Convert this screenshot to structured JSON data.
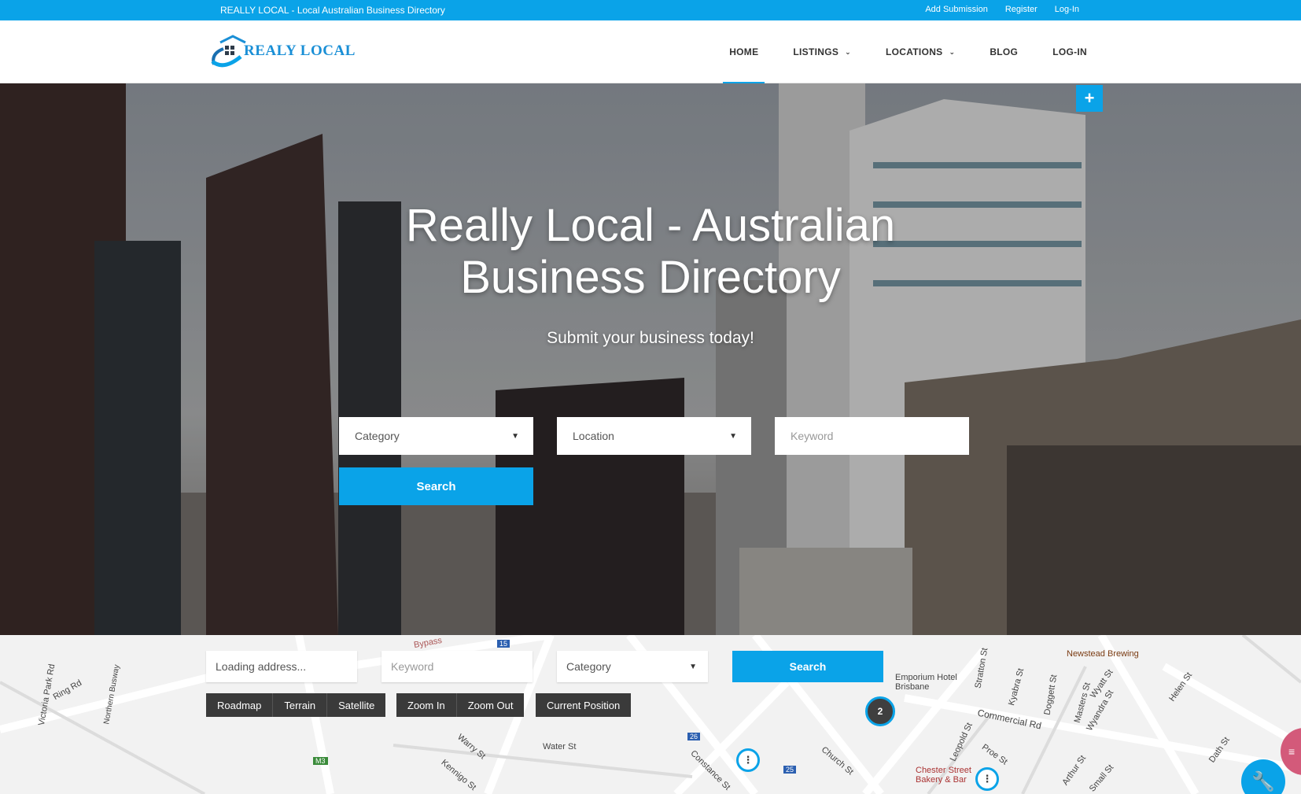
{
  "topbar": {
    "title": "REALLY LOCAL - Local Australian Business Directory",
    "links": [
      "Add Submission",
      "Register",
      "Log-In"
    ]
  },
  "header": {
    "logo_text": "REALY LOCAL",
    "nav": [
      {
        "label": "HOME",
        "active": true,
        "dropdown": false
      },
      {
        "label": "LISTINGS",
        "active": false,
        "dropdown": true
      },
      {
        "label": "LOCATIONS",
        "active": false,
        "dropdown": true
      },
      {
        "label": "BLOG",
        "active": false,
        "dropdown": false
      },
      {
        "label": "LOG-IN",
        "active": false,
        "dropdown": false
      }
    ]
  },
  "hero": {
    "title_line1": "Really Local - Australian",
    "title_line2": "Business Directory",
    "subtitle": "Submit your business today!",
    "category_label": "Category",
    "location_label": "Location",
    "keyword_placeholder": "Keyword",
    "search_label": "Search",
    "plus_label": "+"
  },
  "map": {
    "address_placeholder": "Loading address...",
    "keyword_placeholder": "Keyword",
    "category_label": "Category",
    "search_label": "Search",
    "type_buttons": [
      "Roadmap",
      "Terrain",
      "Satellite"
    ],
    "zoom_buttons": [
      "Zoom In",
      "Zoom Out"
    ],
    "position_button": "Current Position",
    "cluster_count": "2",
    "labels": {
      "newstead": "Newstead Brewing",
      "emporium": "Emporium Hotel Brisbane",
      "chester": "Chester Street Bakery & Bar",
      "commercial": "Commercial Rd",
      "water": "Water St",
      "warry": "Warry St",
      "ring": "Ring Rd",
      "victoria": "Victoria Park Rd",
      "busway": "Northern Busway",
      "bypass": "Bypass",
      "constance": "Constance St",
      "church": "Church St",
      "proe": "Proe St",
      "leopold": "Leopold St",
      "stratton": "Stratton St",
      "kyabra": "Kyabra St",
      "doggett": "Doggett St",
      "masters": "Masters St",
      "wyatt": "Wyatt St",
      "wyandra": "Wyandra St",
      "helen": "Helen St",
      "arthur": "Arthur St",
      "small": "Small St",
      "dath": "Dath St",
      "kennigo": "Kennigo St",
      "m3": "M3",
      "r15": "15",
      "r26": "26",
      "r25": "25"
    }
  }
}
